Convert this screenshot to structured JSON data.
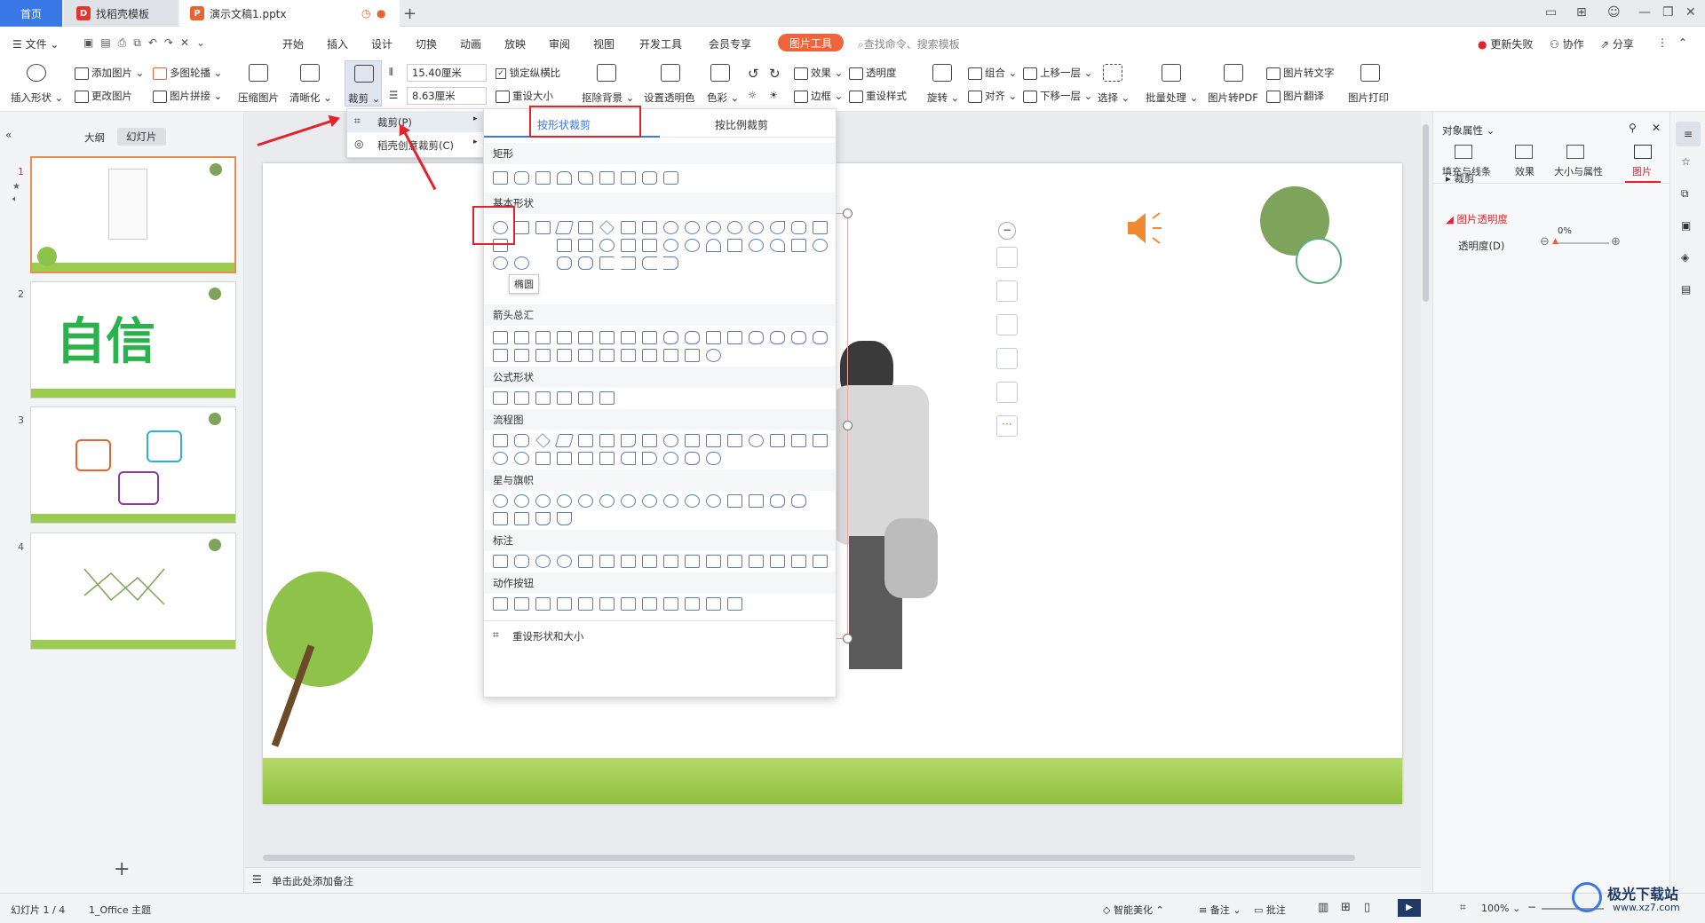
{
  "tabs": {
    "home": "首页",
    "template": "找稻壳模板",
    "document": "演示文稿1.pptx",
    "add": "+"
  },
  "menu": {
    "file": "文件",
    "items": [
      "开始",
      "插入",
      "设计",
      "切换",
      "动画",
      "放映",
      "审阅",
      "视图",
      "开发工具",
      "会员专享"
    ],
    "picture_tools": "图片工具",
    "search_placeholder": "查找命令、搜索模板",
    "update_failed": "更新失败",
    "collaborate": "协作",
    "share": "分享"
  },
  "ribbon": {
    "insert_shape": "插入形状",
    "add_picture": "添加图片",
    "change_picture": "更改图片",
    "multi_outline": "多图轮播",
    "picture_stitch": "图片拼接",
    "compress": "压缩图片",
    "sharpen": "清晰化",
    "crop": "裁剪",
    "width": "15.40厘米",
    "height": "8.63厘米",
    "lock_ratio": "锁定纵横比",
    "reset_size": "重设大小",
    "remove_bg": "抠除背景",
    "set_transparent": "设置透明色",
    "color": "色彩",
    "effects": "效果",
    "transparency": "透明度",
    "border": "边框",
    "reset_style": "重设样式",
    "rotate": "旋转",
    "group": "组合",
    "align": "对齐",
    "bring_forward": "上移一层",
    "send_backward": "下移一层",
    "select": "选择",
    "batch": "批量处理",
    "to_pdf": "图片转PDF",
    "to_text": "图片转文字",
    "translate": "图片翻译",
    "print": "图片打印"
  },
  "crop_menu": {
    "crop": "裁剪(P)",
    "smart_crop": "稻壳创意裁剪(C)"
  },
  "shape_panel": {
    "tab_shape": "按形状裁剪",
    "tab_ratio": "按比例裁剪",
    "sections": [
      "矩形",
      "基本形状",
      "箭头总汇",
      "公式形状",
      "流程图",
      "星与旗帜",
      "标注",
      "动作按钮"
    ],
    "tooltip": "椭圆",
    "reset": "重设形状和大小"
  },
  "left_panel": {
    "outline": "大纲",
    "slides": "幻灯片",
    "slide_numbers": [
      "1",
      "2",
      "3",
      "4"
    ],
    "slide2_text": "自信",
    "add": "+"
  },
  "notes": "单击此处添加备注",
  "right_panel": {
    "title": "对象属性",
    "tabs": [
      "填充与线条",
      "效果",
      "大小与属性",
      "图片"
    ],
    "crop": "裁剪",
    "transparency_section": "图片透明度",
    "transparency_label": "透明度(D)",
    "transparency_value": "0%"
  },
  "status": {
    "slide_info": "幻灯片 1 / 4",
    "theme": "1_Office 主题",
    "smart": "智能美化",
    "notes": "备注",
    "comments": "批注",
    "zoom": "100%"
  },
  "watermark": {
    "name": "极光下载站",
    "url": "www.xz7.com"
  },
  "colors": {
    "accent": "#3b78e7",
    "picture_tool": "#f0643c",
    "annotation": "#e3232b",
    "green": "#7ea35a"
  }
}
